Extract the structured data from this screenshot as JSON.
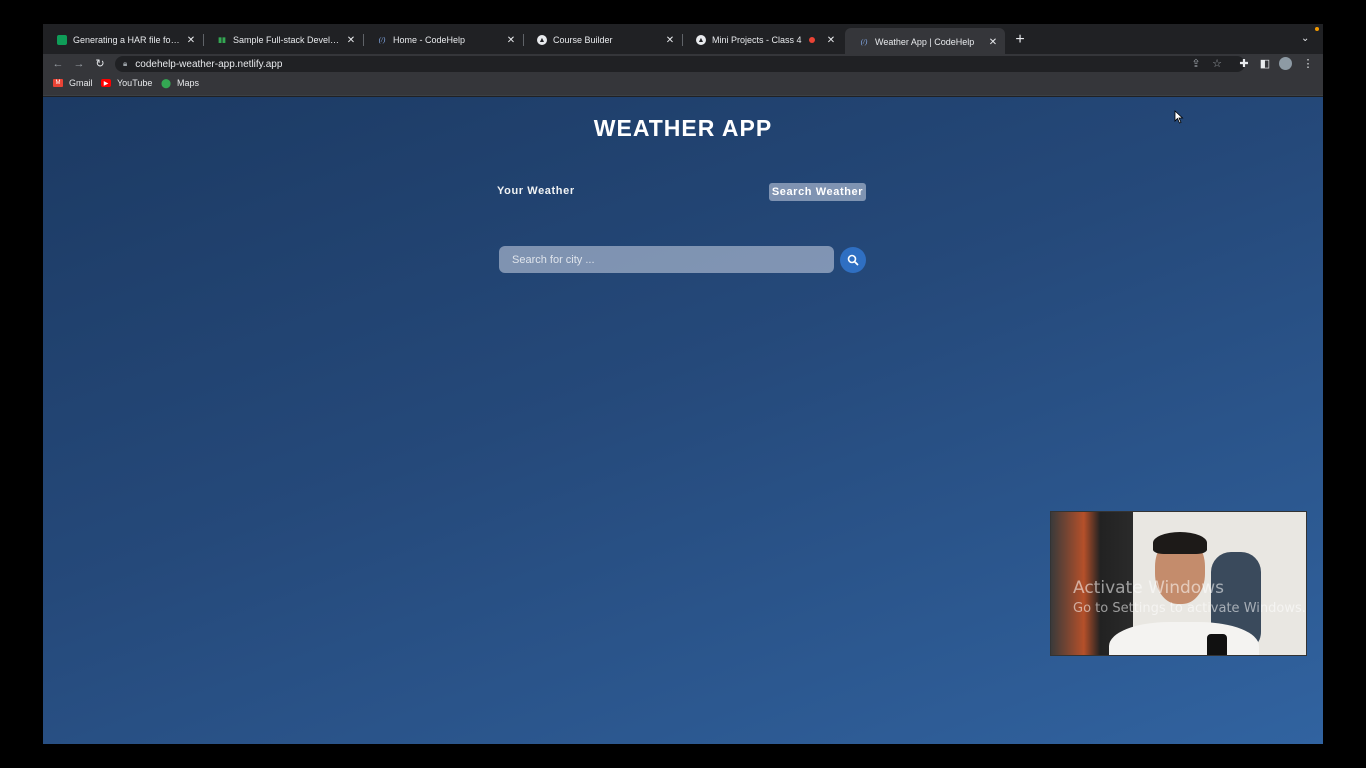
{
  "browser": {
    "tabs": [
      {
        "label": "Generating a HAR file for troub",
        "icon": "green-square-icon",
        "active": false
      },
      {
        "label": "Sample Full-stack Developer H",
        "icon": "bars-icon",
        "active": false
      },
      {
        "label": "Home - CodeHelp",
        "icon": "codehelp-icon",
        "active": false
      },
      {
        "label": "Course Builder",
        "icon": "course-builder-icon",
        "active": false
      },
      {
        "label": "Mini Projects - Class 4",
        "icon": "codehelp-icon",
        "active": false
      },
      {
        "label": "Weather App | CodeHelp",
        "icon": "codehelp-icon",
        "active": true
      }
    ],
    "close_glyph": "✕",
    "new_tab_glyph": "+",
    "url": "codehelp-weather-app.netlify.app",
    "bookmarks": [
      {
        "label": "Gmail",
        "icon": "gmail-icon"
      },
      {
        "label": "YouTube",
        "icon": "youtube-icon"
      },
      {
        "label": "Maps",
        "icon": "maps-icon"
      }
    ]
  },
  "app": {
    "title": "WEATHER APP",
    "tab_your_weather": "Your Weather",
    "tab_search_weather": "Search Weather",
    "search_placeholder": "Search for city ...",
    "search_value": "",
    "colors": {
      "background_start": "#1c3a63",
      "background_end": "#3163a0",
      "search_button": "#2f6fc2"
    }
  },
  "overlay": {
    "watermark_title": "Activate Windows",
    "watermark_subtitle": "Go to Settings to activate Windows."
  }
}
